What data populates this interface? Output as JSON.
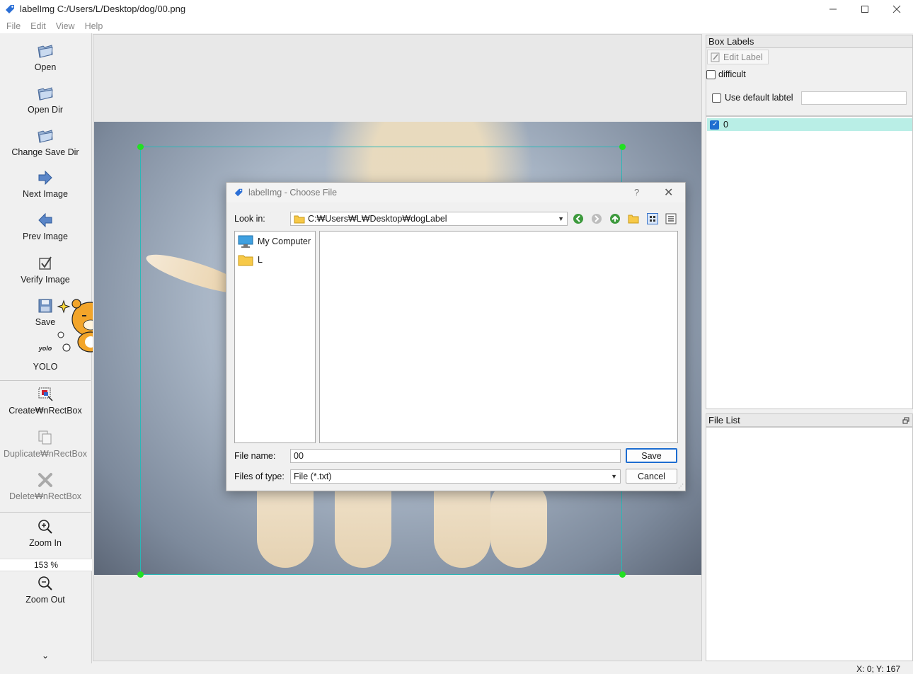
{
  "window": {
    "title": "labelImg C:/Users/L/Desktop/dog/00.png",
    "minimize_icon": "minimize-icon",
    "maximize_icon": "maximize-icon",
    "close_icon": "close-icon"
  },
  "menu": [
    "File",
    "Edit",
    "View",
    "Help"
  ],
  "toolbar": {
    "open": "Open",
    "open_dir": "Open Dir",
    "change_save_dir": "Change Save Dir",
    "next_image": "Next Image",
    "prev_image": "Prev Image",
    "verify_image": "Verify Image",
    "save": "Save",
    "yolo_badge": "yolo",
    "yolo": "YOLO",
    "create_rect": "Create₩nRectBox",
    "duplicate_rect": "Duplicate₩nRectBox",
    "delete_rect": "Delete₩nRectBox",
    "zoom_in": "Zoom In",
    "zoom_level": "153 %",
    "zoom_out": "Zoom Out",
    "more": "⌄"
  },
  "box_labels": {
    "title": "Box Labels",
    "edit_label": "Edit Label",
    "difficult": "difficult",
    "difficult_checked": false,
    "use_default_label": "Use default labtel",
    "use_default_checked": false,
    "default_label_value": "",
    "labels": [
      {
        "text": "0",
        "checked": true
      }
    ]
  },
  "file_list": {
    "title": "File List",
    "files": []
  },
  "status": {
    "coords": "X: 0; Y: 167"
  },
  "dialog": {
    "title": "labelImg - Choose File",
    "help": "?",
    "close": "✕",
    "look_in_label": "Look in:",
    "look_in_path": "C:₩Users₩L₩Desktop₩dogLabel",
    "places": [
      "My Computer",
      "L"
    ],
    "file_name_label": "File name:",
    "file_name_value": "00",
    "files_of_type_label": "Files of type:",
    "files_of_type_value": "File (*.txt)",
    "save_button": "Save",
    "cancel_button": "Cancel"
  },
  "colors": {
    "bbox": "#2ab7b7",
    "handle": "#22e022",
    "label_row": "#b9eee6",
    "default_button": "#1c6cd0"
  }
}
